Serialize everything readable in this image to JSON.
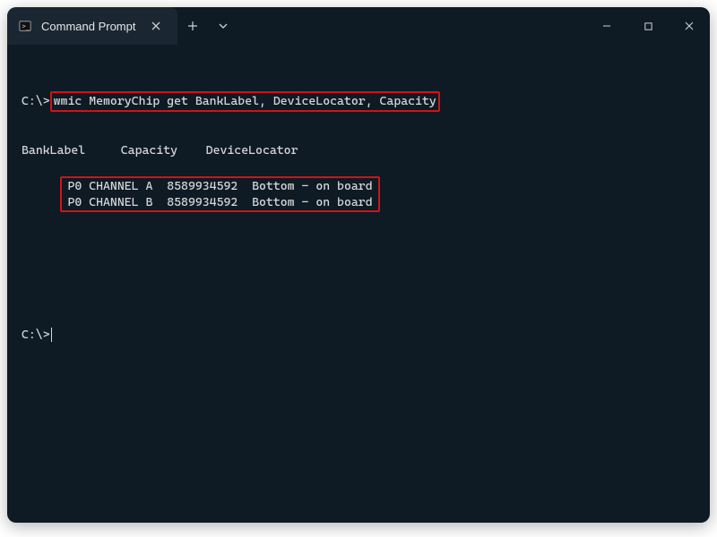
{
  "window": {
    "tab_title": "Command Prompt",
    "tab_icon": "cmd-icon"
  },
  "terminal": {
    "prompt1_prefix": "C:\\>",
    "command": "wmic MemoryChip get BankLabel, DeviceLocator, Capacity",
    "headers": "BankLabel     Capacity    DeviceLocator",
    "rows": [
      "P0 CHANNEL A  8589934592  Bottom - on board",
      "P0 CHANNEL B  8589934592  Bottom - on board"
    ],
    "prompt2_prefix": "C:\\>"
  },
  "chart_data": {
    "type": "table",
    "title": "wmic MemoryChip output",
    "columns": [
      "BankLabel",
      "Capacity",
      "DeviceLocator"
    ],
    "rows": [
      {
        "BankLabel": "P0 CHANNEL A",
        "Capacity": 8589934592,
        "DeviceLocator": "Bottom - on board"
      },
      {
        "BankLabel": "P0 CHANNEL B",
        "Capacity": 8589934592,
        "DeviceLocator": "Bottom - on board"
      }
    ]
  }
}
